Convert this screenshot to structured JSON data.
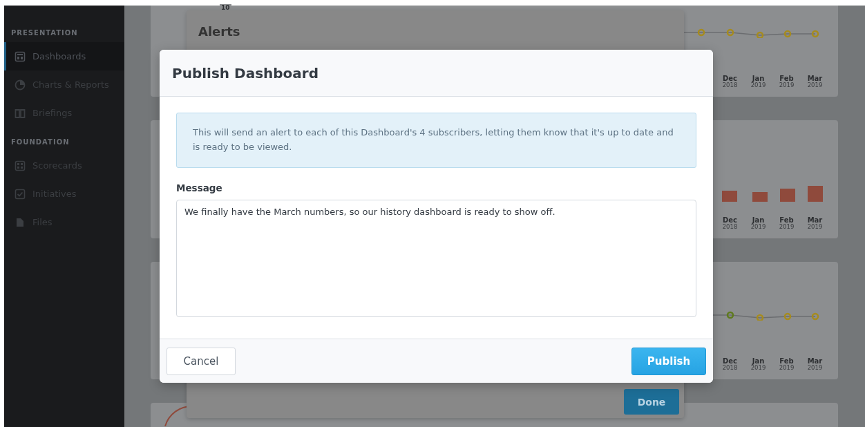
{
  "sidebar": {
    "sections": [
      {
        "title": "PRESENTATION",
        "items": [
          {
            "label": "Dashboards",
            "kind": "dashboard",
            "selected": true
          },
          {
            "label": "Charts & Reports",
            "kind": "pie",
            "selected": false
          },
          {
            "label": "Briefings",
            "kind": "book",
            "selected": false
          }
        ]
      },
      {
        "title": "FOUNDATION",
        "items": [
          {
            "label": "Scorecards",
            "kind": "grid",
            "selected": false
          },
          {
            "label": "Initiatives",
            "kind": "check",
            "selected": false
          },
          {
            "label": "Files",
            "kind": "file",
            "selected": false
          }
        ]
      }
    ]
  },
  "background_cards": [
    {
      "kind": "line",
      "axis_label": "10",
      "months": [
        {
          "month": "Dec",
          "year": "2018"
        },
        {
          "month": "Jan",
          "year": "2019"
        },
        {
          "month": "Feb",
          "year": "2019"
        },
        {
          "month": "Mar",
          "year": "2019"
        }
      ]
    },
    {
      "kind": "bar",
      "months": [
        {
          "month": "Dec",
          "year": "2018"
        },
        {
          "month": "Jan",
          "year": "2019"
        },
        {
          "month": "Feb",
          "year": "2019"
        },
        {
          "month": "Mar",
          "year": "2019"
        }
      ]
    },
    {
      "kind": "line",
      "months": [
        {
          "month": "Dec",
          "year": "2018"
        },
        {
          "month": "Jan",
          "year": "2019"
        },
        {
          "month": "Feb",
          "year": "2019"
        },
        {
          "month": "Mar",
          "year": "2019"
        }
      ]
    },
    {
      "kind": "gauge"
    }
  ],
  "alerts_dialog": {
    "title": "Alerts",
    "done_button": "Done"
  },
  "modal": {
    "title": "Publish Dashboard",
    "notice": "This will send an alert to each of this Dashboard's 4 subscribers, letting them know that it's up to date and is ready to be viewed.",
    "message_label": "Message",
    "message": "We finally have the March numbers, so our history dashboard is ready to show off.",
    "cancel_button": "Cancel",
    "publish_button": "Publish"
  }
}
